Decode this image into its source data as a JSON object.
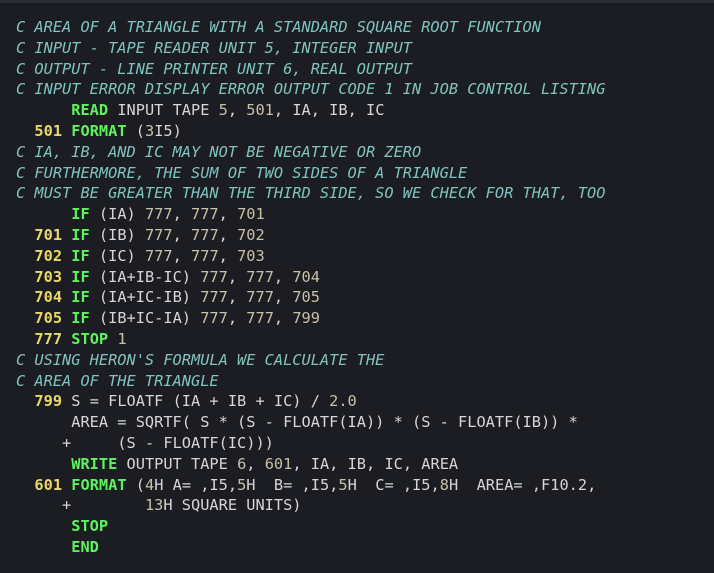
{
  "lines": [
    [
      {
        "t": "comment",
        "v": "C AREA OF A TRIANGLE WITH A STANDARD SQUARE ROOT FUNCTION"
      }
    ],
    [
      {
        "t": "comment",
        "v": "C INPUT - TAPE READER UNIT 5, INTEGER INPUT"
      }
    ],
    [
      {
        "t": "comment",
        "v": "C OUTPUT - LINE PRINTER UNIT 6, REAL OUTPUT"
      }
    ],
    [
      {
        "t": "comment",
        "v": "C INPUT ERROR DISPLAY ERROR OUTPUT CODE 1 IN JOB CONTROL LISTING"
      }
    ],
    [
      {
        "t": "txt",
        "v": "      "
      },
      {
        "t": "kw",
        "v": "READ"
      },
      {
        "t": "txt",
        "v": " INPUT TAPE "
      },
      {
        "t": "num",
        "v": "5"
      },
      {
        "t": "txt",
        "v": ", "
      },
      {
        "t": "num",
        "v": "501"
      },
      {
        "t": "txt",
        "v": ", IA, IB, IC"
      }
    ],
    [
      {
        "t": "label",
        "v": "  501"
      },
      {
        "t": "txt",
        "v": " "
      },
      {
        "t": "kw",
        "v": "FORMAT"
      },
      {
        "t": "txt",
        "v": " ("
      },
      {
        "t": "num",
        "v": "3"
      },
      {
        "t": "txt",
        "v": "I5)"
      }
    ],
    [
      {
        "t": "comment",
        "v": "C IA, IB, AND IC MAY NOT BE NEGATIVE OR ZERO"
      }
    ],
    [
      {
        "t": "comment",
        "v": "C FURTHERMORE, THE SUM OF TWO SIDES OF A TRIANGLE"
      }
    ],
    [
      {
        "t": "comment",
        "v": "C MUST BE GREATER THAN THE THIRD SIDE, SO WE CHECK FOR THAT, TOO"
      }
    ],
    [
      {
        "t": "txt",
        "v": "      "
      },
      {
        "t": "kw",
        "v": "IF"
      },
      {
        "t": "txt",
        "v": " (IA) "
      },
      {
        "t": "num",
        "v": "777"
      },
      {
        "t": "txt",
        "v": ", "
      },
      {
        "t": "num",
        "v": "777"
      },
      {
        "t": "txt",
        "v": ", "
      },
      {
        "t": "num",
        "v": "701"
      }
    ],
    [
      {
        "t": "label",
        "v": "  701"
      },
      {
        "t": "txt",
        "v": " "
      },
      {
        "t": "kw",
        "v": "IF"
      },
      {
        "t": "txt",
        "v": " (IB) "
      },
      {
        "t": "num",
        "v": "777"
      },
      {
        "t": "txt",
        "v": ", "
      },
      {
        "t": "num",
        "v": "777"
      },
      {
        "t": "txt",
        "v": ", "
      },
      {
        "t": "num",
        "v": "702"
      }
    ],
    [
      {
        "t": "label",
        "v": "  702"
      },
      {
        "t": "txt",
        "v": " "
      },
      {
        "t": "kw",
        "v": "IF"
      },
      {
        "t": "txt",
        "v": " (IC) "
      },
      {
        "t": "num",
        "v": "777"
      },
      {
        "t": "txt",
        "v": ", "
      },
      {
        "t": "num",
        "v": "777"
      },
      {
        "t": "txt",
        "v": ", "
      },
      {
        "t": "num",
        "v": "703"
      }
    ],
    [
      {
        "t": "label",
        "v": "  703"
      },
      {
        "t": "txt",
        "v": " "
      },
      {
        "t": "kw",
        "v": "IF"
      },
      {
        "t": "txt",
        "v": " (IA+IB-IC) "
      },
      {
        "t": "num",
        "v": "777"
      },
      {
        "t": "txt",
        "v": ", "
      },
      {
        "t": "num",
        "v": "777"
      },
      {
        "t": "txt",
        "v": ", "
      },
      {
        "t": "num",
        "v": "704"
      }
    ],
    [
      {
        "t": "label",
        "v": "  704"
      },
      {
        "t": "txt",
        "v": " "
      },
      {
        "t": "kw",
        "v": "IF"
      },
      {
        "t": "txt",
        "v": " (IA+IC-IB) "
      },
      {
        "t": "num",
        "v": "777"
      },
      {
        "t": "txt",
        "v": ", "
      },
      {
        "t": "num",
        "v": "777"
      },
      {
        "t": "txt",
        "v": ", "
      },
      {
        "t": "num",
        "v": "705"
      }
    ],
    [
      {
        "t": "label",
        "v": "  705"
      },
      {
        "t": "txt",
        "v": " "
      },
      {
        "t": "kw",
        "v": "IF"
      },
      {
        "t": "txt",
        "v": " (IB+IC-IA) "
      },
      {
        "t": "num",
        "v": "777"
      },
      {
        "t": "txt",
        "v": ", "
      },
      {
        "t": "num",
        "v": "777"
      },
      {
        "t": "txt",
        "v": ", "
      },
      {
        "t": "num",
        "v": "799"
      }
    ],
    [
      {
        "t": "label",
        "v": "  777"
      },
      {
        "t": "txt",
        "v": " "
      },
      {
        "t": "kw",
        "v": "STOP"
      },
      {
        "t": "txt",
        "v": " "
      },
      {
        "t": "num",
        "v": "1"
      }
    ],
    [
      {
        "t": "comment",
        "v": "C USING HERON'S FORMULA WE CALCULATE THE"
      }
    ],
    [
      {
        "t": "comment",
        "v": "C AREA OF THE TRIANGLE"
      }
    ],
    [
      {
        "t": "label",
        "v": "  799"
      },
      {
        "t": "txt",
        "v": " S = FLOATF (IA + IB + IC) / "
      },
      {
        "t": "num",
        "v": "2.0"
      }
    ],
    [
      {
        "t": "txt",
        "v": "      AREA = SQRTF( S * (S - FLOATF(IA)) * (S - FLOATF(IB)) *"
      }
    ],
    [
      {
        "t": "cont",
        "v": "     +"
      },
      {
        "t": "txt",
        "v": "     (S - FLOATF(IC)))"
      }
    ],
    [
      {
        "t": "txt",
        "v": "      "
      },
      {
        "t": "kw",
        "v": "WRITE"
      },
      {
        "t": "txt",
        "v": " OUTPUT TAPE "
      },
      {
        "t": "num",
        "v": "6"
      },
      {
        "t": "txt",
        "v": ", "
      },
      {
        "t": "num",
        "v": "601"
      },
      {
        "t": "txt",
        "v": ", IA, IB, IC, AREA"
      }
    ],
    [
      {
        "t": "label",
        "v": "  601"
      },
      {
        "t": "txt",
        "v": " "
      },
      {
        "t": "kw",
        "v": "FORMAT"
      },
      {
        "t": "txt",
        "v": " ("
      },
      {
        "t": "num",
        "v": "4"
      },
      {
        "t": "txt",
        "v": "H A= ,I5,"
      },
      {
        "t": "num",
        "v": "5"
      },
      {
        "t": "txt",
        "v": "H  B= ,I5,"
      },
      {
        "t": "num",
        "v": "5"
      },
      {
        "t": "txt",
        "v": "H  C= ,I5,"
      },
      {
        "t": "num",
        "v": "8"
      },
      {
        "t": "txt",
        "v": "H  AREA= ,F10.2,"
      }
    ],
    [
      {
        "t": "cont",
        "v": "     +"
      },
      {
        "t": "txt",
        "v": "        "
      },
      {
        "t": "num",
        "v": "13"
      },
      {
        "t": "txt",
        "v": "H SQUARE UNITS)"
      }
    ],
    [
      {
        "t": "txt",
        "v": "      "
      },
      {
        "t": "kw",
        "v": "STOP"
      }
    ],
    [
      {
        "t": "txt",
        "v": "      "
      },
      {
        "t": "kw",
        "v": "END"
      }
    ]
  ],
  "colors": {
    "background": "#1c1d22",
    "comment": "#7fc4c0",
    "label": "#e8d86a",
    "keyword": "#5ef35e",
    "number": "#c9c0a8",
    "text": "#d6d6d6"
  }
}
